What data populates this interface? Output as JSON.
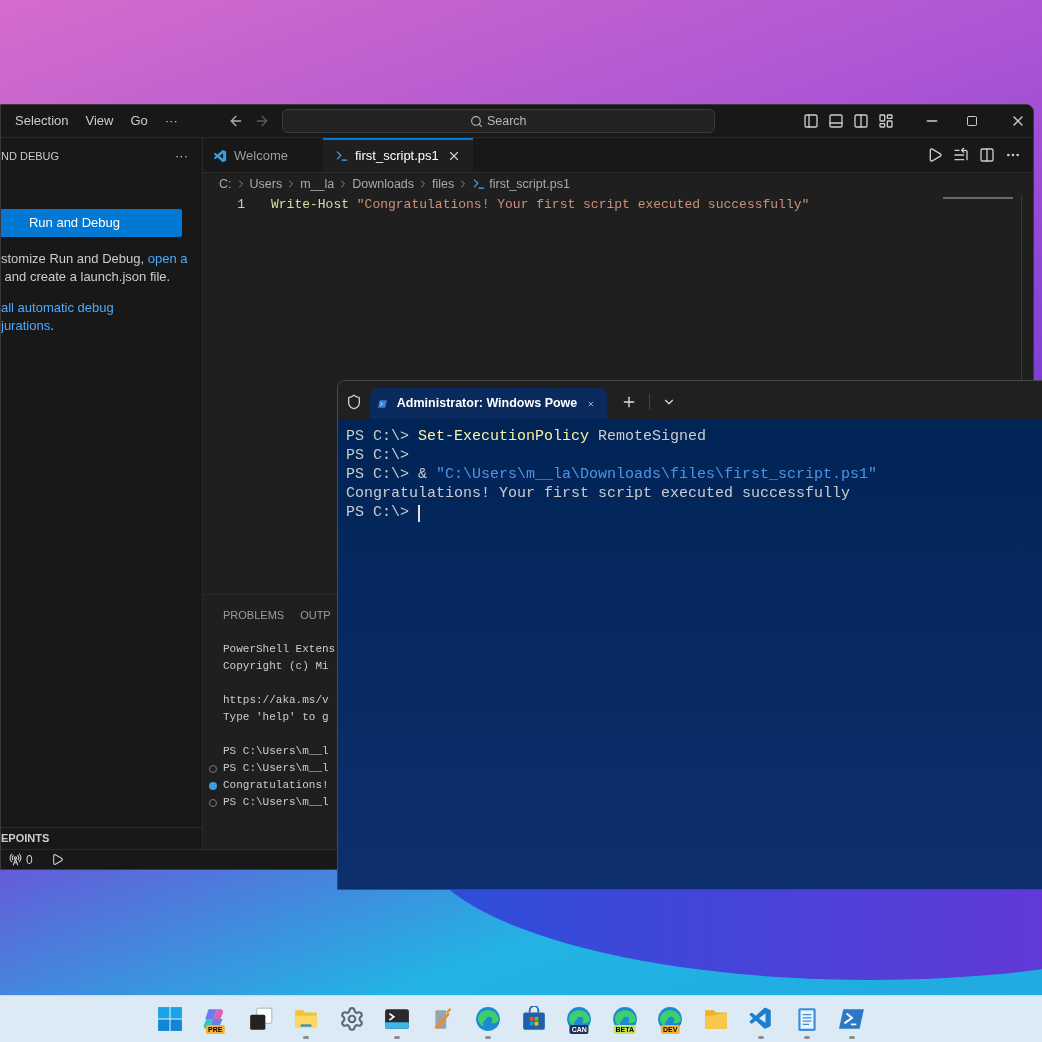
{
  "vscode": {
    "menu": [
      "Selection",
      "View",
      "Go",
      "···"
    ],
    "search": {
      "placeholder": "Search"
    },
    "sidebar": {
      "title": "ND DEBUG",
      "more": "···",
      "run_button": "Run and Debug",
      "paragraphs": [
        {
          "lines": [
            [
              {
                "text": "stomize Run and Debug, ",
                "kind": "text"
              },
              {
                "text": "open a",
                "kind": "link"
              }
            ],
            [
              {
                "text": " and create a launch.json file.",
                "kind": "text"
              }
            ]
          ]
        },
        {
          "lines": [
            [
              {
                "text": "all automatic debug",
                "kind": "link"
              }
            ],
            [
              {
                "text": "jurations",
                "kind": "link"
              },
              {
                "text": ".",
                "kind": "text"
              }
            ]
          ]
        }
      ],
      "section": "EPOINTS"
    },
    "tabs": [
      {
        "label": "Welcome",
        "kind": "welcome",
        "selected": false
      },
      {
        "label": "first_script.ps1",
        "kind": "powershell",
        "selected": true
      }
    ],
    "breadcrumb": [
      {
        "label": "C:",
        "kind": "text"
      },
      {
        "label": "Users",
        "kind": "text"
      },
      {
        "label": "m__la",
        "kind": "text"
      },
      {
        "label": "Downloads",
        "kind": "text"
      },
      {
        "label": "files",
        "kind": "text"
      },
      {
        "label": "first_script.ps1",
        "kind": "powershell"
      }
    ],
    "editor": {
      "line_number": "1",
      "segments": [
        {
          "text": "Write-Host",
          "kind": "command"
        },
        {
          "text": "\"Congratulations! Your first script executed successfully\"",
          "kind": "string"
        }
      ]
    },
    "panel": {
      "tabs": [
        {
          "label": "PROBLEMS",
          "selected": false
        },
        {
          "label": "OUTP",
          "selected": false
        }
      ],
      "blocks": [
        [
          {
            "text": "PowerShell Extens",
            "kind": "output"
          },
          {
            "text": "Copyright (c) Mi",
            "kind": "output"
          }
        ],
        [
          {
            "text": "https://aka.ms/v",
            "kind": "output"
          },
          {
            "text": "Type 'help' to g",
            "kind": "output"
          }
        ],
        [
          {
            "text": "PS C:\\Users\\m__l",
            "kind": "output"
          },
          {
            "text": "PS C:\\Users\\m__l",
            "kind": "command"
          },
          {
            "text": "Congratulations!",
            "kind": "success"
          },
          {
            "text": "PS C:\\Users\\m__l",
            "kind": "command"
          }
        ]
      ]
    },
    "status_bar": {
      "ports": "0"
    }
  },
  "terminal": {
    "tab": {
      "title": "Administrator: Windows Powe",
      "selected": true
    },
    "lines": [
      {
        "segments": [
          {
            "text": "PS C:\\> ",
            "kind": "prompt"
          },
          {
            "text": "Set-ExecutionPolicy",
            "kind": "command"
          },
          {
            "text": " RemoteSigned",
            "kind": "plain"
          }
        ],
        "cursor": false
      },
      {
        "segments": [
          {
            "text": "PS C:\\>",
            "kind": "prompt"
          }
        ],
        "cursor": false
      },
      {
        "segments": [
          {
            "text": "PS C:\\> ",
            "kind": "prompt"
          },
          {
            "text": "& ",
            "kind": "plain"
          },
          {
            "text": "\"C:\\Users\\m__la\\Downloads\\files\\first_script.ps1\"",
            "kind": "string"
          }
        ],
        "cursor": false
      },
      {
        "segments": [
          {
            "text": "Congratulations! Your first script executed successfully",
            "kind": "plain"
          }
        ],
        "cursor": false
      },
      {
        "segments": [
          {
            "text": "PS C:\\> ",
            "kind": "prompt"
          }
        ],
        "cursor": true
      }
    ]
  },
  "taskbar": {
    "apps": [
      {
        "kind": "start",
        "running": false
      },
      {
        "kind": "copilot",
        "badge": "PRE",
        "running": false
      },
      {
        "kind": "taskview",
        "running": false
      },
      {
        "kind": "folder",
        "running": true
      },
      {
        "kind": "settings",
        "running": false
      },
      {
        "kind": "terminal",
        "running": true
      },
      {
        "kind": "tools",
        "running": false
      },
      {
        "kind": "edge",
        "running": true
      },
      {
        "kind": "store",
        "running": false
      },
      {
        "kind": "edge",
        "badge": "CAN",
        "running": false
      },
      {
        "kind": "edge",
        "badge": "BETA",
        "running": false
      },
      {
        "kind": "edge",
        "badge": "DEV",
        "running": false
      },
      {
        "kind": "files",
        "running": false
      },
      {
        "kind": "vscode",
        "running": true
      },
      {
        "kind": "notepad",
        "running": true
      },
      {
        "kind": "powershell",
        "running": true
      }
    ]
  }
}
